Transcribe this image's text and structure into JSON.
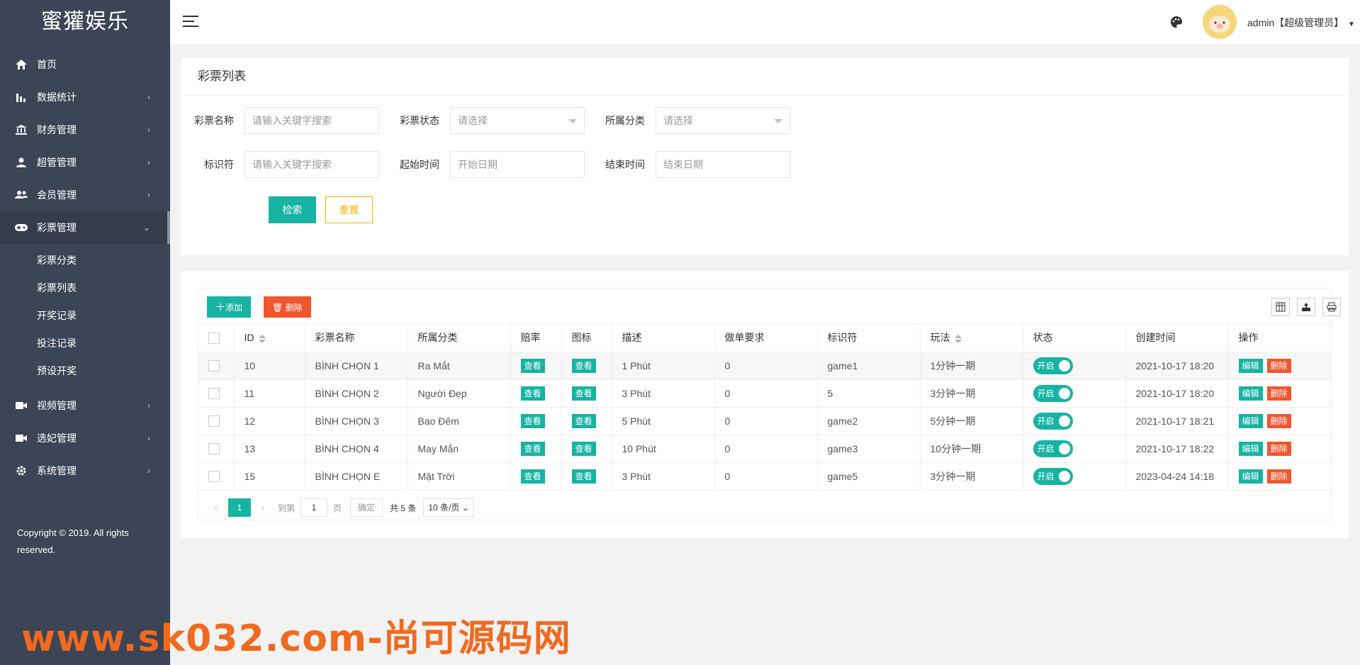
{
  "sidebar": {
    "logo": "蜜獾娱乐",
    "items": [
      {
        "label": "首页",
        "icon": "home-icon"
      },
      {
        "label": "数据统计",
        "icon": "bar-chart-icon"
      },
      {
        "label": "财务管理",
        "icon": "bank-icon"
      },
      {
        "label": "超管管理",
        "icon": "user-icon"
      },
      {
        "label": "会员管理",
        "icon": "users-icon"
      },
      {
        "label": "彩票管理",
        "icon": "gamepad-icon"
      },
      {
        "label": "视频管理",
        "icon": "video-icon"
      },
      {
        "label": "选妃管理",
        "icon": "video-icon"
      },
      {
        "label": "系统管理",
        "icon": "gear-icon"
      }
    ],
    "sub_items": [
      "彩票分类",
      "彩票列表",
      "开奖记录",
      "投注记录",
      "预设开奖"
    ],
    "copyright": "Copyright © 2019. All rights reserved."
  },
  "header": {
    "user": "admin【超级管理员】"
  },
  "filter": {
    "title": "彩票列表",
    "name_label": "彩票名称",
    "name_placeholder": "请输入关键字搜索",
    "status_label": "彩票状态",
    "status_value": "请选择",
    "category_label": "所属分类",
    "category_value": "请选择",
    "key_label": "标识符",
    "key_placeholder": "请输入关键字搜索",
    "start_label": "起始时间",
    "start_placeholder": "开始日期",
    "end_label": "结束时间",
    "end_placeholder": "结束日期",
    "search_btn": "检索",
    "reset_btn": "重置"
  },
  "table": {
    "add_btn": "添加",
    "delete_btn": "删除",
    "columns": [
      "ID",
      "彩票名称",
      "所属分类",
      "赔率",
      "图标",
      "描述",
      "做单要求",
      "标识符",
      "玩法",
      "状态",
      "创建时间",
      "操作"
    ],
    "view_label": "查看",
    "edit_label": "编辑",
    "del_label": "删除",
    "switch_label": "开启",
    "rows": [
      {
        "id": "10",
        "name": "BÌNH CHỌN 1",
        "category": "Ra Mắt",
        "desc": "1 Phút",
        "req": "0",
        "key": "game1",
        "play": "1分钟一期",
        "created": "2021-10-17 18:20"
      },
      {
        "id": "11",
        "name": "BÌNH CHỌN 2",
        "category": "Người Đẹp",
        "desc": "3 Phút",
        "req": "0",
        "key": "5",
        "play": "3分钟一期",
        "created": "2021-10-17 18:20"
      },
      {
        "id": "12",
        "name": "BÌNH CHỌN 3",
        "category": "Bao Đêm",
        "desc": "5 Phút",
        "req": "0",
        "key": "game2",
        "play": "5分钟一期",
        "created": "2021-10-17 18:21"
      },
      {
        "id": "13",
        "name": "BÌNH CHỌN 4",
        "category": "May Mắn",
        "desc": "10 Phút",
        "req": "0",
        "key": "game3",
        "play": "10分钟一期",
        "created": "2021-10-17 18:22"
      },
      {
        "id": "15",
        "name": "BÌNH CHỌN E",
        "category": "Mặt Trời",
        "desc": "3 Phút",
        "req": "0",
        "key": "game5",
        "play": "3分钟一期",
        "created": "2023-04-24 14:18"
      }
    ]
  },
  "pager": {
    "current": "1",
    "goto_label": "到第",
    "goto_value": "1",
    "page_unit": "页",
    "confirm": "确定",
    "total": "共 5 条",
    "page_size": "10 条/页"
  },
  "watermark": "www.sk032.com-尚可源码网",
  "colors": {
    "accent": "#17b3a3",
    "danger": "#f0562e",
    "warning": "#f5b40a",
    "sidebar": "#3c4556"
  }
}
